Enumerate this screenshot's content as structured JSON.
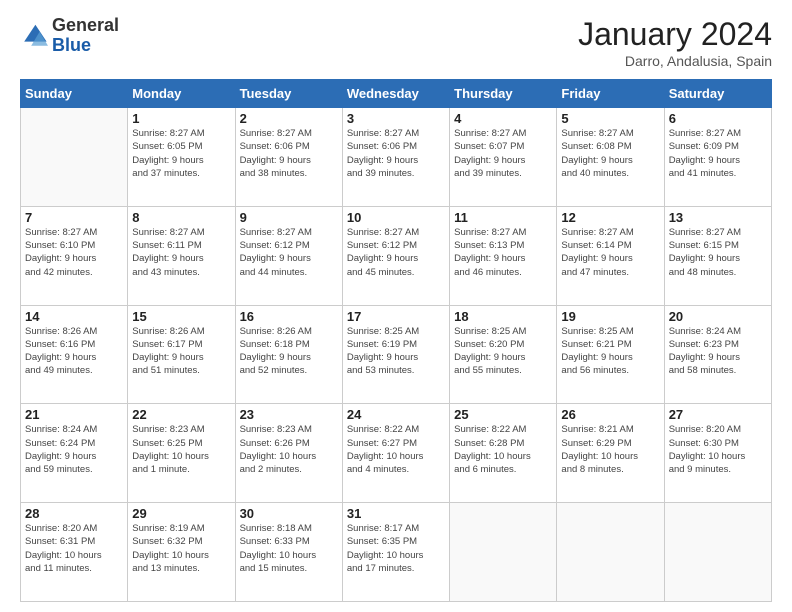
{
  "logo": {
    "general": "General",
    "blue": "Blue"
  },
  "title": "January 2024",
  "location": "Darro, Andalusia, Spain",
  "days_of_week": [
    "Sunday",
    "Monday",
    "Tuesday",
    "Wednesday",
    "Thursday",
    "Friday",
    "Saturday"
  ],
  "weeks": [
    [
      {
        "day": "",
        "info": ""
      },
      {
        "day": "1",
        "info": "Sunrise: 8:27 AM\nSunset: 6:05 PM\nDaylight: 9 hours\nand 37 minutes."
      },
      {
        "day": "2",
        "info": "Sunrise: 8:27 AM\nSunset: 6:06 PM\nDaylight: 9 hours\nand 38 minutes."
      },
      {
        "day": "3",
        "info": "Sunrise: 8:27 AM\nSunset: 6:06 PM\nDaylight: 9 hours\nand 39 minutes."
      },
      {
        "day": "4",
        "info": "Sunrise: 8:27 AM\nSunset: 6:07 PM\nDaylight: 9 hours\nand 39 minutes."
      },
      {
        "day": "5",
        "info": "Sunrise: 8:27 AM\nSunset: 6:08 PM\nDaylight: 9 hours\nand 40 minutes."
      },
      {
        "day": "6",
        "info": "Sunrise: 8:27 AM\nSunset: 6:09 PM\nDaylight: 9 hours\nand 41 minutes."
      }
    ],
    [
      {
        "day": "7",
        "info": "Sunrise: 8:27 AM\nSunset: 6:10 PM\nDaylight: 9 hours\nand 42 minutes."
      },
      {
        "day": "8",
        "info": "Sunrise: 8:27 AM\nSunset: 6:11 PM\nDaylight: 9 hours\nand 43 minutes."
      },
      {
        "day": "9",
        "info": "Sunrise: 8:27 AM\nSunset: 6:12 PM\nDaylight: 9 hours\nand 44 minutes."
      },
      {
        "day": "10",
        "info": "Sunrise: 8:27 AM\nSunset: 6:12 PM\nDaylight: 9 hours\nand 45 minutes."
      },
      {
        "day": "11",
        "info": "Sunrise: 8:27 AM\nSunset: 6:13 PM\nDaylight: 9 hours\nand 46 minutes."
      },
      {
        "day": "12",
        "info": "Sunrise: 8:27 AM\nSunset: 6:14 PM\nDaylight: 9 hours\nand 47 minutes."
      },
      {
        "day": "13",
        "info": "Sunrise: 8:27 AM\nSunset: 6:15 PM\nDaylight: 9 hours\nand 48 minutes."
      }
    ],
    [
      {
        "day": "14",
        "info": "Sunrise: 8:26 AM\nSunset: 6:16 PM\nDaylight: 9 hours\nand 49 minutes."
      },
      {
        "day": "15",
        "info": "Sunrise: 8:26 AM\nSunset: 6:17 PM\nDaylight: 9 hours\nand 51 minutes."
      },
      {
        "day": "16",
        "info": "Sunrise: 8:26 AM\nSunset: 6:18 PM\nDaylight: 9 hours\nand 52 minutes."
      },
      {
        "day": "17",
        "info": "Sunrise: 8:25 AM\nSunset: 6:19 PM\nDaylight: 9 hours\nand 53 minutes."
      },
      {
        "day": "18",
        "info": "Sunrise: 8:25 AM\nSunset: 6:20 PM\nDaylight: 9 hours\nand 55 minutes."
      },
      {
        "day": "19",
        "info": "Sunrise: 8:25 AM\nSunset: 6:21 PM\nDaylight: 9 hours\nand 56 minutes."
      },
      {
        "day": "20",
        "info": "Sunrise: 8:24 AM\nSunset: 6:23 PM\nDaylight: 9 hours\nand 58 minutes."
      }
    ],
    [
      {
        "day": "21",
        "info": "Sunrise: 8:24 AM\nSunset: 6:24 PM\nDaylight: 9 hours\nand 59 minutes."
      },
      {
        "day": "22",
        "info": "Sunrise: 8:23 AM\nSunset: 6:25 PM\nDaylight: 10 hours\nand 1 minute."
      },
      {
        "day": "23",
        "info": "Sunrise: 8:23 AM\nSunset: 6:26 PM\nDaylight: 10 hours\nand 2 minutes."
      },
      {
        "day": "24",
        "info": "Sunrise: 8:22 AM\nSunset: 6:27 PM\nDaylight: 10 hours\nand 4 minutes."
      },
      {
        "day": "25",
        "info": "Sunrise: 8:22 AM\nSunset: 6:28 PM\nDaylight: 10 hours\nand 6 minutes."
      },
      {
        "day": "26",
        "info": "Sunrise: 8:21 AM\nSunset: 6:29 PM\nDaylight: 10 hours\nand 8 minutes."
      },
      {
        "day": "27",
        "info": "Sunrise: 8:20 AM\nSunset: 6:30 PM\nDaylight: 10 hours\nand 9 minutes."
      }
    ],
    [
      {
        "day": "28",
        "info": "Sunrise: 8:20 AM\nSunset: 6:31 PM\nDaylight: 10 hours\nand 11 minutes."
      },
      {
        "day": "29",
        "info": "Sunrise: 8:19 AM\nSunset: 6:32 PM\nDaylight: 10 hours\nand 13 minutes."
      },
      {
        "day": "30",
        "info": "Sunrise: 8:18 AM\nSunset: 6:33 PM\nDaylight: 10 hours\nand 15 minutes."
      },
      {
        "day": "31",
        "info": "Sunrise: 8:17 AM\nSunset: 6:35 PM\nDaylight: 10 hours\nand 17 minutes."
      },
      {
        "day": "",
        "info": ""
      },
      {
        "day": "",
        "info": ""
      },
      {
        "day": "",
        "info": ""
      }
    ]
  ]
}
